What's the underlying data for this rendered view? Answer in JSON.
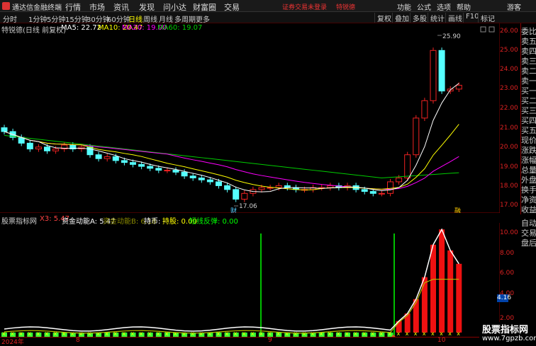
{
  "app": {
    "title": "通达信金融终端",
    "menus": [
      "行情",
      "市场",
      "资讯",
      "发现",
      "问小达",
      "财富圈",
      "交易"
    ],
    "notice": "证券交易未登录",
    "stock_tag": "特锐德",
    "right_menus": [
      "功能",
      "公式",
      "选项",
      "帮助"
    ],
    "guest": "游客"
  },
  "toolbar": {
    "periods": [
      "分时",
      "1分钟",
      "5分钟",
      "15分钟",
      "30分钟",
      "60分钟",
      "日线",
      "周线",
      "月线",
      "多周期",
      "更多"
    ],
    "active": "日线",
    "right": [
      "复权",
      "叠加",
      "多股",
      "统计",
      "画线",
      "F10",
      "标记"
    ]
  },
  "main": {
    "stock_name": "特锐德(日线 前复权)",
    "ma5": "MA5: 22.72",
    "ma10": "MA10: 20.47",
    "ma20": "MA20: 19.00",
    "ma60": "MA60: 19.07",
    "high_label": "25.90",
    "low_label": "17.06",
    "marker_cai": "财",
    "marker_rong": "融"
  },
  "price_axis": [
    "26.00",
    "25.00",
    "24.00",
    "23.00",
    "22.00",
    "21.00",
    "20.00",
    "19.00",
    "18.00",
    "17.00"
  ],
  "right_panel": [
    "委比",
    "卖五",
    "卖四",
    "卖三",
    "卖二",
    "卖一",
    "买一",
    "买二",
    "买三",
    "买四",
    "买五",
    "现价",
    "涨跌",
    "涨幅",
    "总量",
    "外盘",
    "换手",
    "净资",
    "收益"
  ],
  "sub": {
    "name": "股票指标网",
    "x3": "X3: 5.47",
    "zjA": "资金动能A: 5.47",
    "zjB": "资金动能B: 6.18",
    "chibi": "持币: -",
    "chiyou": "持股: 0.00",
    "short": "短线反弹: 0.00",
    "right": [
      "自动",
      "交易",
      "盘后"
    ]
  },
  "sub_axis": [
    "10.00",
    "8.00",
    "6.00",
    "4.00",
    "2.00"
  ],
  "sub_highlight": "4.16",
  "dates": [
    "2024年",
    "8",
    "9",
    "10"
  ],
  "watermark": {
    "line1": "股票指标网",
    "line2": "www.7gpzb.com"
  },
  "colors": {
    "up": "#e22",
    "down": "#5ff",
    "ma5": "#fff",
    "ma10": "#ff0",
    "ma20": "#f0f",
    "ma60": "#0c0"
  }
}
